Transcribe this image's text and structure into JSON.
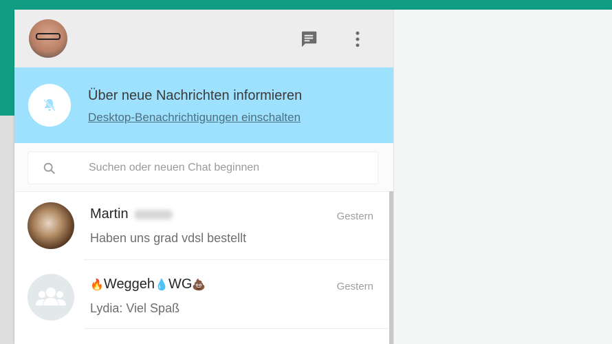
{
  "header": {
    "self_avatar_icon": "user-avatar-photo",
    "new_chat_icon": "chat-bubble-icon",
    "menu_icon": "more-vertical-icon"
  },
  "notification": {
    "icon": "bell-off-icon",
    "title": "Über neue Nachrichten informieren",
    "link": "Desktop-Benachrichtigungen einschalten",
    "background": "#9de1fe"
  },
  "search": {
    "icon": "search-icon",
    "placeholder": "Suchen oder neuen Chat beginnen"
  },
  "chats": [
    {
      "name": "Martin",
      "time": "Gestern",
      "message": "Haben uns grad vdsl bestellt",
      "avatar": "contact-photo"
    },
    {
      "name_emoji_1": "🔥",
      "name_part_1": "Weggeh",
      "name_emoji_2": "💧",
      "name_part_2": "WG",
      "name_emoji_3": "💩",
      "time": "Gestern",
      "message": "Lydia: Viel Spaß",
      "avatar": "group-icon"
    }
  ],
  "colors": {
    "accent_teal": "#0f9d84",
    "header_bg": "#ededed"
  }
}
